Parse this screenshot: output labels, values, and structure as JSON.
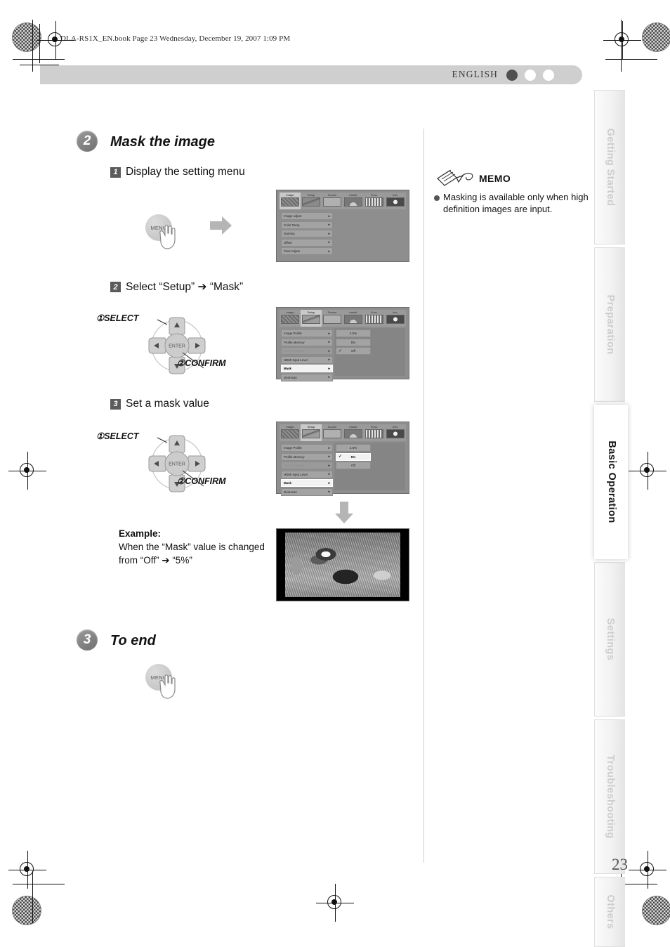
{
  "document": {
    "file_banner": "DLA-RS1X_EN.book  Page 23  Wednesday, December 19, 2007  1:09 PM",
    "language": "ENGLISH",
    "page_number": "23"
  },
  "index_tabs": [
    {
      "label": "Getting Started",
      "active": false
    },
    {
      "label": "Preparation",
      "active": false
    },
    {
      "label": "Basic Operation",
      "active": true
    },
    {
      "label": "Settings",
      "active": false
    },
    {
      "label": "Troubleshooting",
      "active": false
    },
    {
      "label": "Others",
      "active": false
    }
  ],
  "sections": [
    {
      "number": "2",
      "title": "Mask the image"
    },
    {
      "number": "3",
      "title": "To end"
    }
  ],
  "steps": [
    {
      "number": "1",
      "text": "Display the setting menu"
    },
    {
      "number": "2",
      "text": "Select “Setup”  ➔  “Mask”"
    },
    {
      "number": "3",
      "text": "Set a mask value"
    }
  ],
  "remote": {
    "menu_label": "MENU",
    "enter_label": "ENTER",
    "select_label": "①SELECT",
    "confirm_label": "②CONFIRM"
  },
  "osd": {
    "tabs": [
      "Image",
      "Setup",
      "Source",
      "Install.",
      "Func.",
      "Info."
    ],
    "menu1": {
      "selected_tab": "Image",
      "items": [
        {
          "label": "Image Adjust",
          "arrow": "▸",
          "dim": false,
          "highlight": false
        },
        {
          "label": "Color Temp.",
          "arrow": "▸",
          "dim": false,
          "highlight": false
        },
        {
          "label": "Gamma",
          "arrow": "▸",
          "dim": false,
          "highlight": false
        },
        {
          "label": "Offset",
          "arrow": "▸",
          "dim": false,
          "highlight": false
        },
        {
          "label": "Pixel Adjust",
          "arrow": "▸",
          "dim": false,
          "highlight": false
        }
      ],
      "values": []
    },
    "menu2": {
      "selected_tab": "Setup",
      "items": [
        {
          "label": "Image Profile",
          "arrow": "▸",
          "dim": false,
          "highlight": false
        },
        {
          "label": "Profile Memory",
          "arrow": "▸",
          "dim": false,
          "highlight": false
        },
        {
          "label": "Picture Position",
          "arrow": "▸",
          "dim": true,
          "highlight": false
        },
        {
          "label": "HDMI Input Level",
          "arrow": "▸",
          "dim": false,
          "highlight": false
        },
        {
          "label": "Mask",
          "arrow": "▸",
          "dim": false,
          "highlight": true
        },
        {
          "label": "Overscan",
          "arrow": "▸",
          "dim": false,
          "highlight": false
        }
      ],
      "values": [
        {
          "label": "2.5%",
          "checked": false,
          "highlight": false
        },
        {
          "label": "5%",
          "checked": false,
          "highlight": false
        },
        {
          "label": "Off",
          "checked": true,
          "highlight": false
        }
      ]
    },
    "menu3": {
      "selected_tab": "Setup",
      "items": [
        {
          "label": "Image Profile",
          "arrow": "▸",
          "dim": false,
          "highlight": false
        },
        {
          "label": "Profile Memory",
          "arrow": "▸",
          "dim": false,
          "highlight": false
        },
        {
          "label": "Picture Position",
          "arrow": "▸",
          "dim": true,
          "highlight": false
        },
        {
          "label": "HDMI Input Level",
          "arrow": "▸",
          "dim": false,
          "highlight": false
        },
        {
          "label": "Mask",
          "arrow": "▸",
          "dim": false,
          "highlight": true
        },
        {
          "label": "Overscan",
          "arrow": "▸",
          "dim": false,
          "highlight": false
        }
      ],
      "values": [
        {
          "label": "2.5%",
          "checked": false,
          "highlight": false
        },
        {
          "label": "5%",
          "checked": true,
          "highlight": true
        },
        {
          "label": "Off",
          "checked": false,
          "highlight": false
        }
      ]
    }
  },
  "example": {
    "label": "Example:",
    "line1": "When the “Mask” value is changed",
    "line2": "from “Off”  ➔  “5%”"
  },
  "memo": {
    "title": "MEMO",
    "text": "Masking is available only when high definition images are input."
  },
  "colors": {
    "accent": "#cfcfcf",
    "osd_bg": "#8e8e8e",
    "tab_inactive_text": "#cdcdcd",
    "step_circle": "#7c7c7c"
  }
}
